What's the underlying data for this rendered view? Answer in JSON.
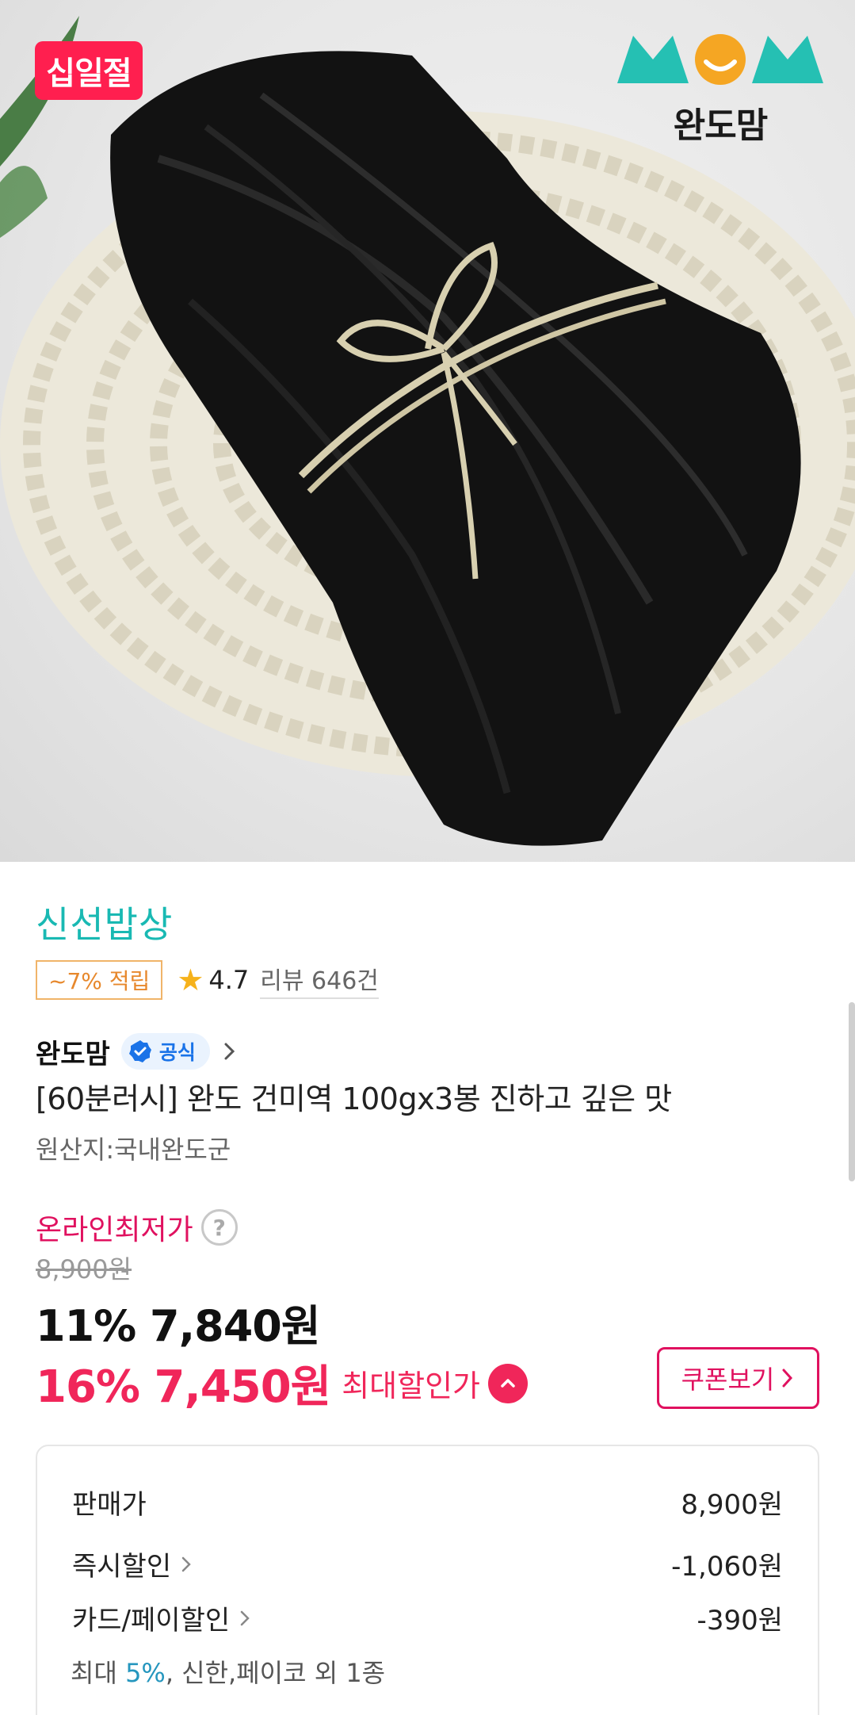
{
  "hero": {
    "sale_badge": "십일절",
    "brand_logo_text": "MOM",
    "brand_name": "완도맘",
    "colors": {
      "sale_badge": "#ff1f4f",
      "logo_teal": "#25c0b3",
      "logo_orange": "#f5a623"
    }
  },
  "store": {
    "name": "신선밥상"
  },
  "rating": {
    "point_badge": "~7% 적립",
    "score": "4.7",
    "review_text": "리뷰 646건"
  },
  "seller": {
    "name": "완도맘",
    "official_label": "공식"
  },
  "product": {
    "title": "[60분러시] 완도 건미역 100gx3봉 진하고 깊은 맛",
    "origin": "원산지:국내완도군"
  },
  "price": {
    "lowest_label": "온라인최저가",
    "help_icon": "?",
    "original": "8,900원",
    "discount1": "11% 7,840원",
    "max_discount": "16% 7,450원",
    "max_label": "최대할인가",
    "coupon_button": "쿠폰보기"
  },
  "breakdown": {
    "sale_price_label": "판매가",
    "sale_price_value": "8,900원",
    "instant_label": "즉시할인",
    "instant_value": "-1,060원",
    "card_label": "카드/페이할인",
    "card_value": "-390원",
    "card_sub_prefix": "최대 ",
    "card_sub_highlight": "5%",
    "card_sub_suffix": ", 신한,페이코 외 1종"
  },
  "colors": {
    "store_teal": "#19b9b3",
    "price_pink": "#f0265a",
    "point_orange": "#e7882c",
    "official_blue": "#1a73e8"
  }
}
